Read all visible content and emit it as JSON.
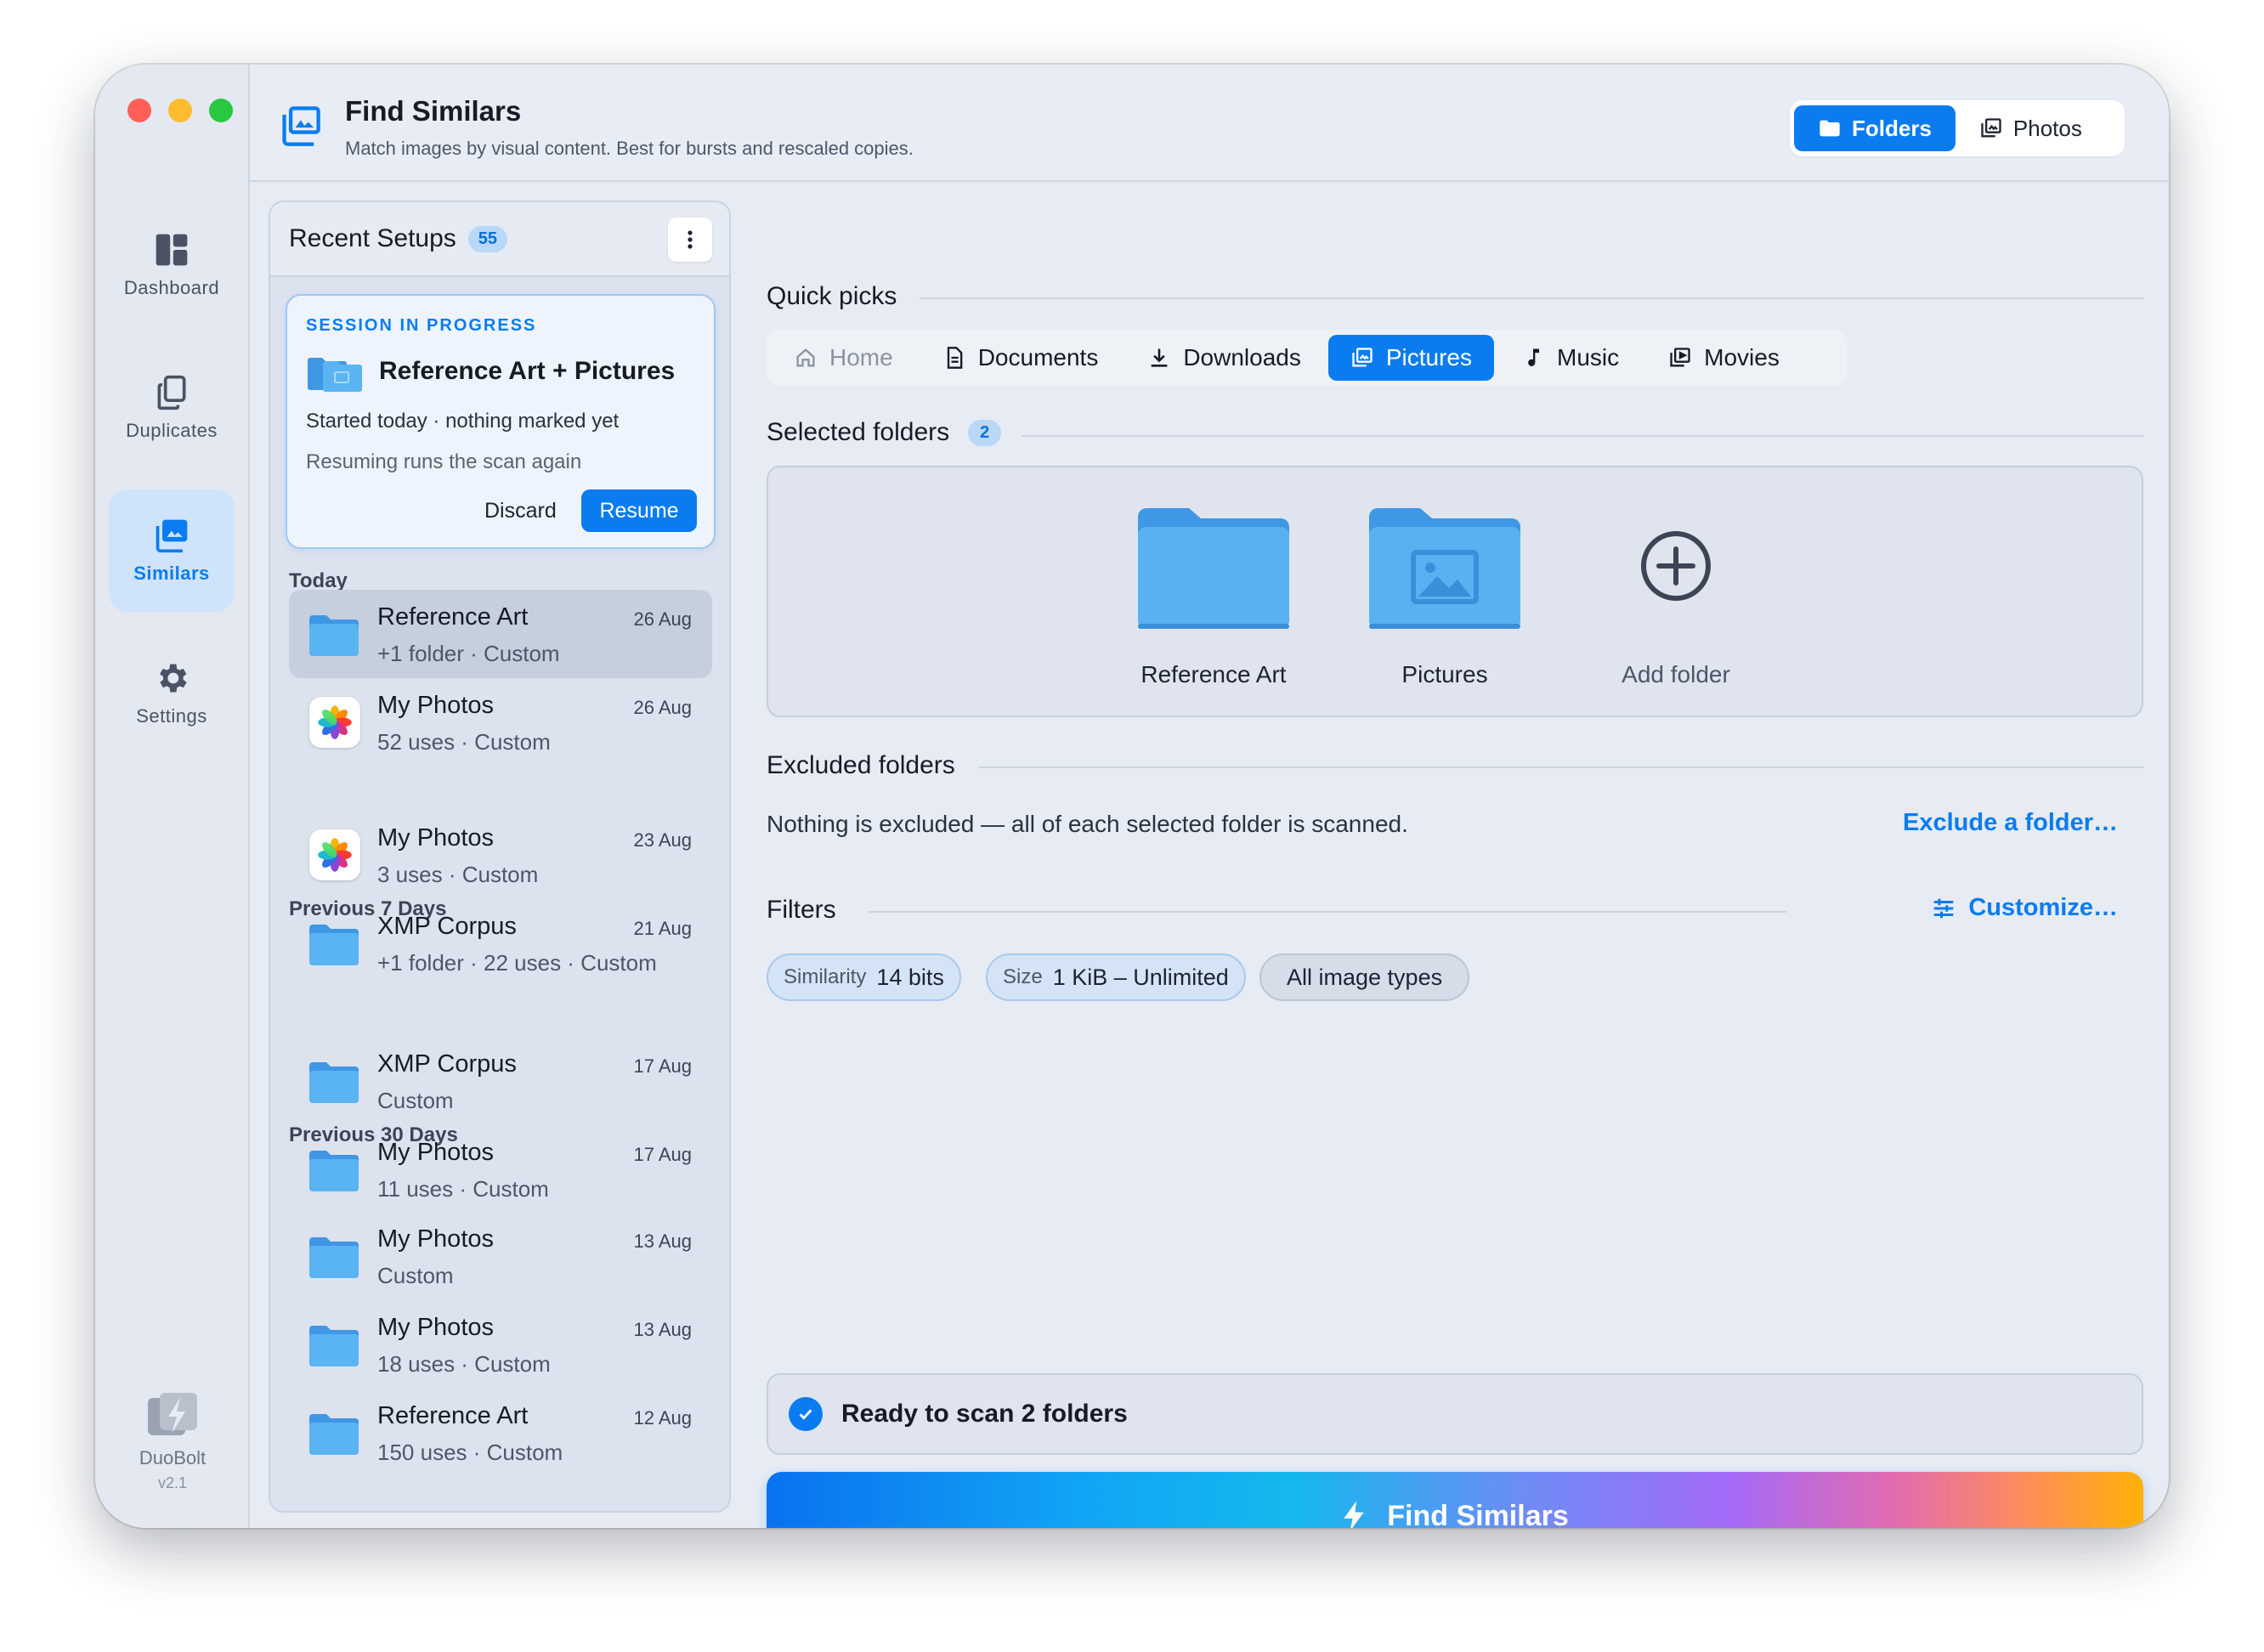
{
  "window": {
    "title": "Find Similars",
    "subtitle": "Match images by visual content. Best for bursts and rescaled copies."
  },
  "mode_toggle": {
    "folders": "Folders",
    "photos": "Photos",
    "selected": "Folders"
  },
  "nav": [
    {
      "label": "Dashboard",
      "icon": "dashboard-icon"
    },
    {
      "label": "Duplicates",
      "icon": "duplicates-icon"
    },
    {
      "label": "Similars",
      "icon": "similars-icon",
      "active": true
    },
    {
      "label": "Settings",
      "icon": "gear-icon"
    }
  ],
  "brand": {
    "name": "DuoBolt",
    "version": "v2.1"
  },
  "recent": {
    "title": "Recent Setups",
    "count": "55",
    "session": {
      "tag": "SESSION IN PROGRESS",
      "title": "Reference Art + Pictures",
      "line1": "Started today · nothing marked yet",
      "line2": "Resuming runs the scan again",
      "discard": "Discard",
      "resume": "Resume"
    },
    "groups": {
      "today": "Today",
      "prev7": "Previous 7 Days",
      "prev30": "Previous 30 Days"
    },
    "items": [
      {
        "name": "Reference Art",
        "sub": "+1 folder · Custom",
        "date": "26 Aug",
        "icon": "folder-icon"
      },
      {
        "name": "My Photos",
        "sub": "52 uses · Custom",
        "date": "26 Aug",
        "icon": "photos-app-icon"
      },
      {
        "name": "My Photos",
        "sub": "3 uses · Custom",
        "date": "23 Aug",
        "icon": "photos-app-icon"
      },
      {
        "name": "XMP Corpus",
        "sub": "+1 folder · 22 uses · Custom",
        "date": "21 Aug",
        "icon": "folder-icon"
      },
      {
        "name": "XMP Corpus",
        "sub": "Custom",
        "date": "17 Aug",
        "icon": "folder-icon"
      },
      {
        "name": "My Photos",
        "sub": "11 uses · Custom",
        "date": "17 Aug",
        "icon": "folder-icon"
      },
      {
        "name": "My Photos",
        "sub": "Custom",
        "date": "13 Aug",
        "icon": "folder-icon"
      },
      {
        "name": "My Photos",
        "sub": "18 uses · Custom",
        "date": "13 Aug",
        "icon": "folder-icon"
      },
      {
        "name": "Reference Art",
        "sub": "150 uses · Custom",
        "date": "12 Aug",
        "icon": "folder-icon"
      }
    ]
  },
  "quick_picks": {
    "title": "Quick picks",
    "items": [
      {
        "label": "Home",
        "icon": "home-icon",
        "state": "disabled"
      },
      {
        "label": "Documents",
        "icon": "document-icon"
      },
      {
        "label": "Downloads",
        "icon": "download-icon"
      },
      {
        "label": "Pictures",
        "icon": "pictures-icon",
        "state": "active"
      },
      {
        "label": "Music",
        "icon": "music-icon"
      },
      {
        "label": "Movies",
        "icon": "movies-icon"
      }
    ]
  },
  "selected": {
    "title": "Selected folders",
    "count": "2",
    "folders": [
      {
        "label": "Reference Art",
        "icon": "folder-icon"
      },
      {
        "label": "Pictures",
        "icon": "pictures-folder-icon"
      }
    ],
    "add_label": "Add folder"
  },
  "excluded": {
    "title": "Excluded folders",
    "text": "Nothing is excluded — all of each selected folder is scanned.",
    "link": "Exclude a folder…"
  },
  "filters": {
    "title": "Filters",
    "customize": "Customize…",
    "chips": [
      {
        "key": "Similarity",
        "value": "14 bits"
      },
      {
        "key": "Size",
        "value": "1 KiB – Unlimited"
      },
      {
        "key": "",
        "value": "All image types"
      }
    ]
  },
  "status": {
    "text": "Ready to scan 2 folders"
  },
  "cta": {
    "label": "Find Similars"
  },
  "colors": {
    "accent": "#0a7cf0",
    "folder": "#4aa8ef"
  }
}
